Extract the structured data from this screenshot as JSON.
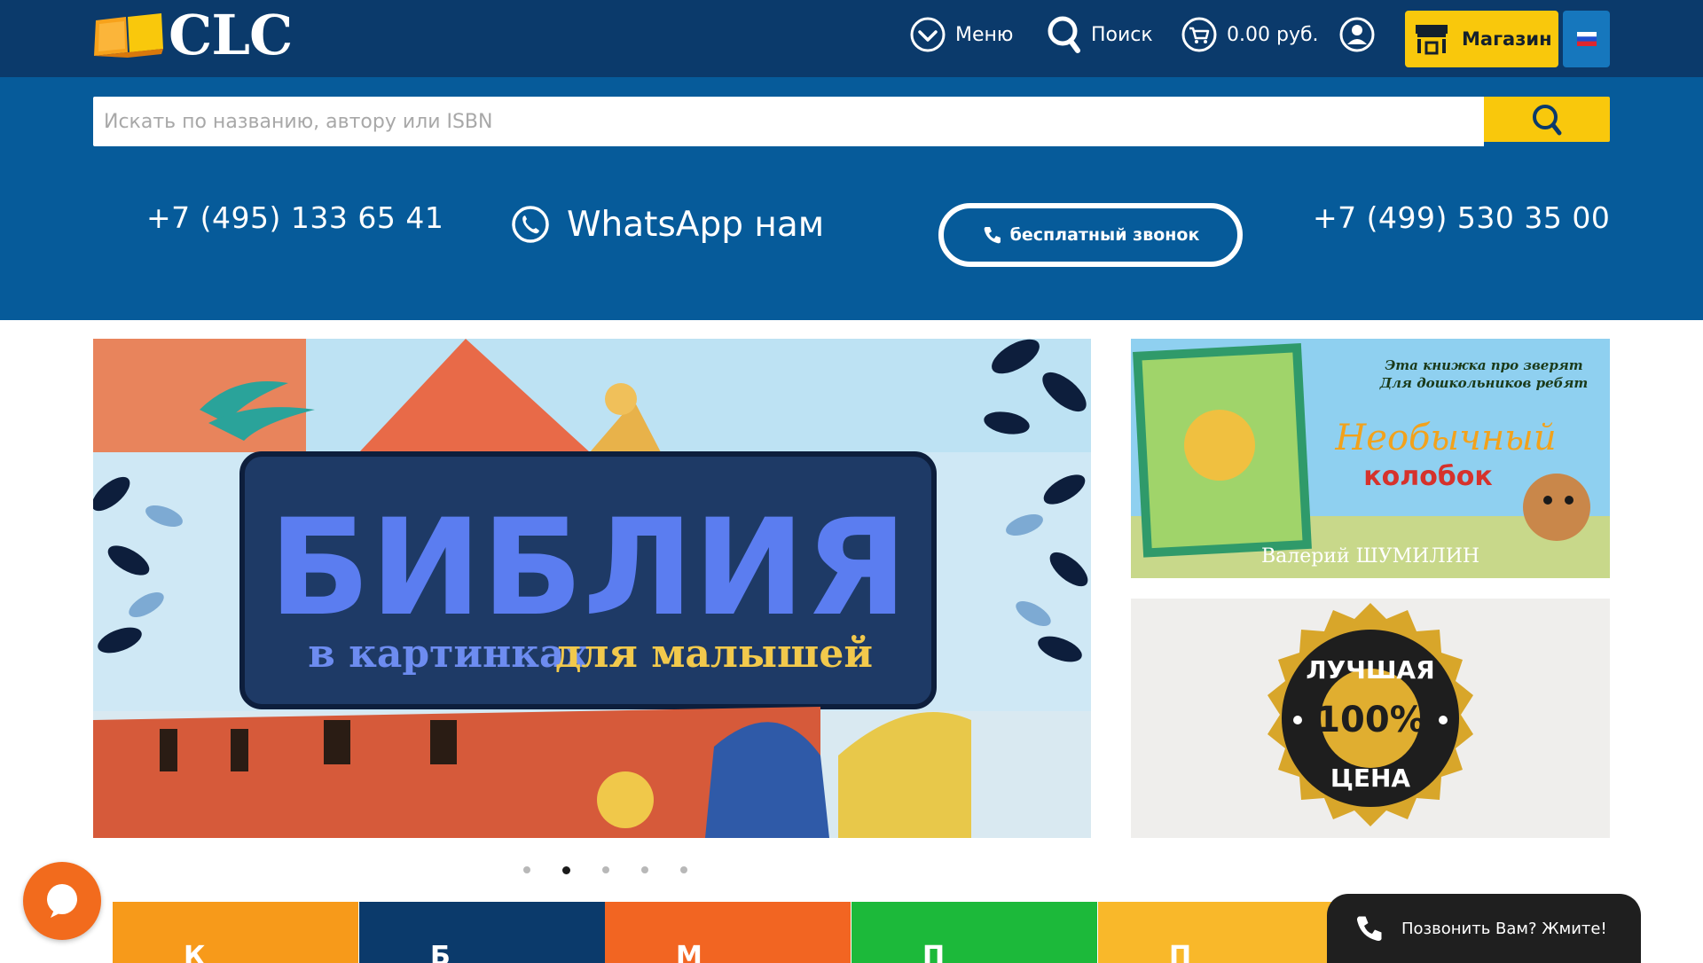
{
  "header": {
    "logo_text": "CLC",
    "menu_label": "Меню",
    "search_label": "Поиск",
    "cart_total": "0.00 руб.",
    "shop_label": "Магазин"
  },
  "search": {
    "placeholder": "Искать по названию, автору или ISBN"
  },
  "contacts": {
    "phone_1": "+7 (495) 133 65 41",
    "whatsapp_label": "WhatsApp нам",
    "free_call_label": "бесплатный звонок",
    "phone_2": "+7 (499) 530 35 00"
  },
  "slider": {
    "title": "БИБЛИЯ",
    "subtitle_part1": "в картинках",
    "subtitle_part2": "для малышей",
    "dots_count": 5,
    "active_dot": 2
  },
  "banners": {
    "book_tagline_1": "Эта книжка про зверят",
    "book_tagline_2": "Для дошкольников ребят",
    "book_title_1": "Необычный",
    "book_title_2": "колобок",
    "book_author": "Валерий ШУМИЛИН",
    "badge_top": "ЛУЧШАЯ",
    "badge_center": "100%",
    "badge_bottom": "ЦЕНА"
  },
  "tiles": [
    {
      "label": "К",
      "color": "#f79a1a"
    },
    {
      "label": "Б",
      "color": "#0b3a6b"
    },
    {
      "label": "М",
      "color": "#f26522"
    },
    {
      "label": "П",
      "color": "#1cb93a"
    },
    {
      "label": "П",
      "color": "#f9b82a"
    }
  ],
  "callback": {
    "label": "Позвонить Вам? Жмите!"
  },
  "colors": {
    "navbar": "#0b3a6b",
    "band": "#065b9a",
    "accent": "#f9c80c",
    "chat": "#f26b1d"
  },
  "icons": {
    "menu": "chevron-circle-icon",
    "search": "magnifier-icon",
    "cart": "cart-icon",
    "account": "user-icon",
    "shop": "storefront-icon",
    "lang": "russia-flag-icon",
    "whatsapp": "whatsapp-icon",
    "phone": "phone-icon",
    "chat": "chat-bubble-icon"
  }
}
